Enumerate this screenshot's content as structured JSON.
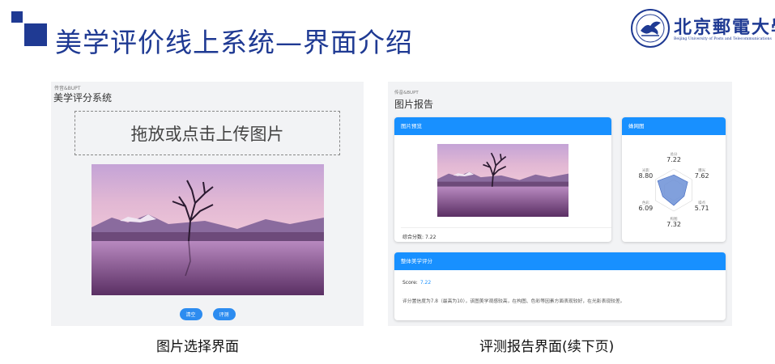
{
  "slide": {
    "title": "美学评价线上系统—界面介绍",
    "accent_color": "#1f3a93"
  },
  "logo": {
    "name_cn": "北京郵電大學",
    "name_en": "Beijing University of Posts and Telecommunications"
  },
  "left_screen": {
    "brand": "传音&BUPT",
    "title": "美学评分系统",
    "upload_text": "拖放或点击上传图片",
    "buttons": {
      "clear": "清空",
      "evaluate": "评测"
    },
    "caption": "图片选择界面"
  },
  "right_screen": {
    "brand": "传音&BUPT",
    "title": "图片报告",
    "preview_card": {
      "header": "图片预览",
      "overall_label": "综合分数:",
      "overall_value": "7.22"
    },
    "radar_card": {
      "header": "蛛网图",
      "axes": [
        {
          "label": "总分",
          "value": "7.22"
        },
        {
          "label": "曝光",
          "value": "7.62"
        },
        {
          "label": "噪点",
          "value": "5.71"
        },
        {
          "label": "构图",
          "value": "7.32"
        },
        {
          "label": "色彩",
          "value": "6.09"
        },
        {
          "label": "光影",
          "value": "8.80"
        }
      ],
      "fill_color": "#6b8fd6"
    },
    "overall_card": {
      "header": "整体美学评分",
      "score_label": "Score:",
      "score_value": "7.22",
      "description": "评分置信度为7.8（最高为10），该图美学观感较高，在构图、色彩等因素方面表现较好，在光影表现较差。"
    },
    "caption": "评测报告界面(续下页)"
  },
  "colors": {
    "primary_button": "#2d8cf0",
    "card_header": "#1890ff"
  }
}
